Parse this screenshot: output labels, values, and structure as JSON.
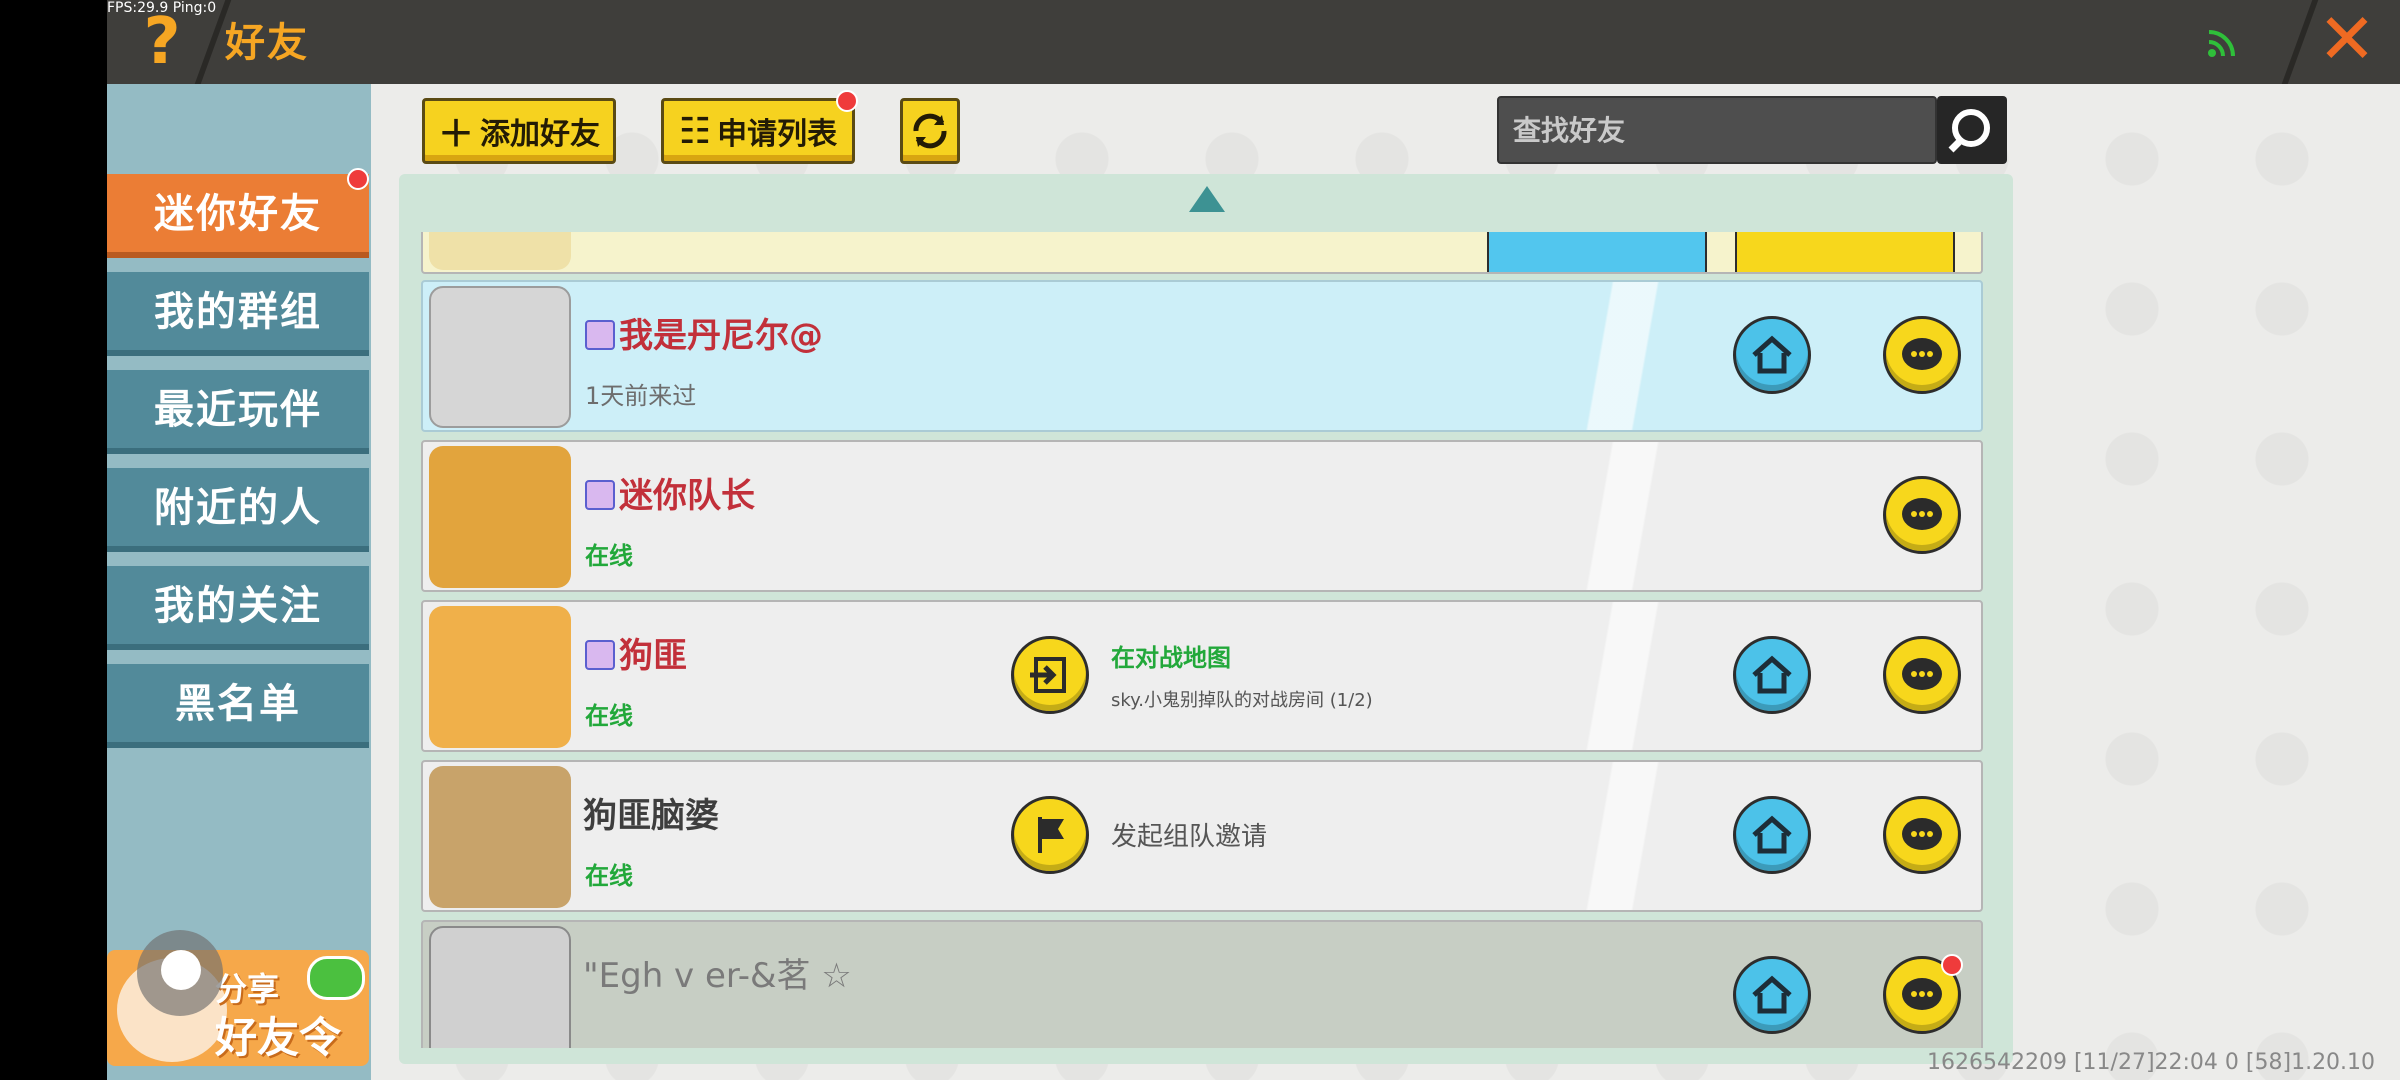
{
  "topbar": {
    "fps": "FPS:29.9  Ping:0",
    "help": "?",
    "title": "好友",
    "close": "✕"
  },
  "sidebar": {
    "items": [
      {
        "label": "迷你好友",
        "active": true,
        "dot": true
      },
      {
        "label": "我的群组"
      },
      {
        "label": "最近玩伴"
      },
      {
        "label": "附近的人"
      },
      {
        "label": "我的关注"
      },
      {
        "label": "黑名单"
      }
    ],
    "share": {
      "line1": "分享",
      "line2": "好友令"
    }
  },
  "toolbar": {
    "add_friend": "添加好友",
    "request_list": "申请列表",
    "search_placeholder": "查找好友"
  },
  "friends": [
    {
      "name": "我是丹尼尔@",
      "status": "1天前来过",
      "vip": true
    },
    {
      "name": "迷你队长",
      "status": "在线",
      "vip": true
    },
    {
      "name": "狗匪",
      "status": "在线",
      "vip": true,
      "room_title": "在对战地图",
      "room_sub": "sky.小鬼别掉队的对战房间 (1/2)"
    },
    {
      "name": "狗匪脑婆",
      "status": "在线",
      "invite": "发起组队邀请"
    },
    {
      "name": "\"Egh v er-&茗 ☆"
    }
  ],
  "footer": "1626542209    [11/27]22:04 0   [58]1.20.10",
  "colors": {
    "accent": "#eb7d35",
    "sidebar": "#528a9a",
    "online": "#22a83a",
    "vip_name": "#c2303a"
  }
}
